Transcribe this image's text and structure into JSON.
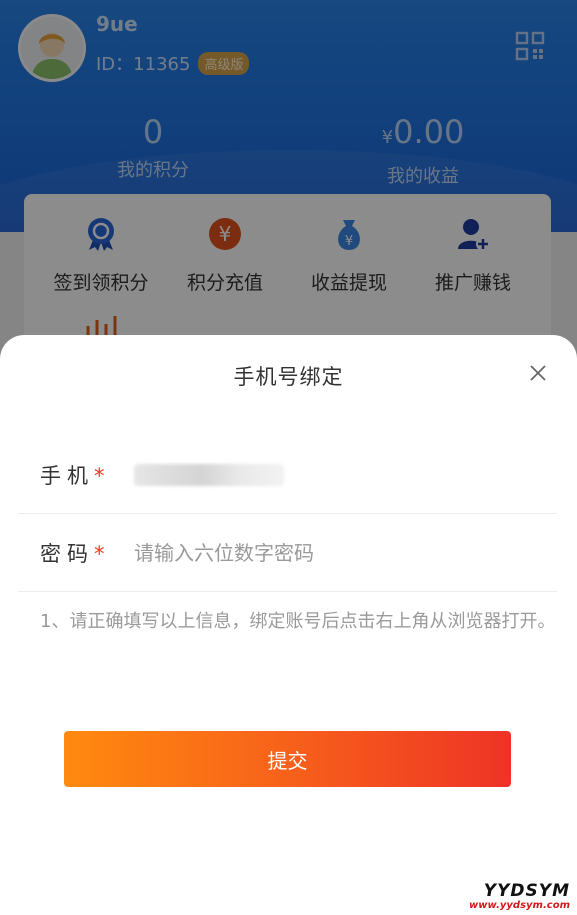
{
  "profile": {
    "username": "9ue",
    "id_text": "ID：11365",
    "badge": "高级版",
    "qr_icon": "qrcode-icon"
  },
  "stats": {
    "points_value": "0",
    "points_label": "我的积分",
    "income_currency": "¥",
    "income_value": "0.00",
    "income_label": "我的收益"
  },
  "menu": [
    {
      "label": "签到领积分",
      "icon": "badge-ribbon-icon"
    },
    {
      "label": "积分充值",
      "icon": "yen-coin-icon"
    },
    {
      "label": "收益提现",
      "icon": "money-bag-icon"
    },
    {
      "label": "推广赚钱",
      "icon": "user-add-icon"
    }
  ],
  "sheet": {
    "title": "手机号绑定",
    "close_icon": "close-icon",
    "phone_label": "手机",
    "password_label": "密码",
    "required_mark": "*",
    "password_placeholder": "请输入六位数字密码",
    "note": "1、请正确填写以上信息，绑定账号后点击右上角从浏览器打开。",
    "submit_label": "提交"
  },
  "watermark": {
    "main": "YYDSYM",
    "sub": "www.yydsym.com"
  },
  "colors": {
    "header_blue": "#2a83e8",
    "accent_orange": "#ff8a10",
    "accent_red": "#ee3326",
    "required_red": "#ee3a22"
  }
}
